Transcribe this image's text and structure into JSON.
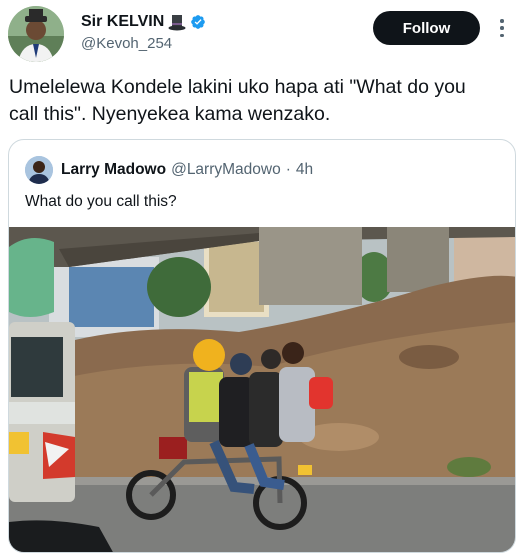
{
  "author": {
    "display_name": "Sir KELVIN",
    "handle": "@Kevoh_254",
    "verified": true
  },
  "follow_label": "Follow",
  "tweet": {
    "text_line1": "Umelelewa Kondele lakini uko hapa ati \"What do you",
    "text_line2": "call this\". Nyenyekea kama wenzako."
  },
  "quoted_tweet": {
    "display_name": "Larry Madowo",
    "handle": "@LarryMadowo",
    "separator": "·",
    "time": "4h",
    "text": "What do you call this?"
  },
  "media": {
    "description_icon": "photo",
    "motorbike_plate_icon": "plate"
  },
  "colors": {
    "follow_bg": "#0f1419",
    "verified_blue": "#1d9bf0",
    "secondary_text": "#536471",
    "border": "#cfd9de"
  }
}
